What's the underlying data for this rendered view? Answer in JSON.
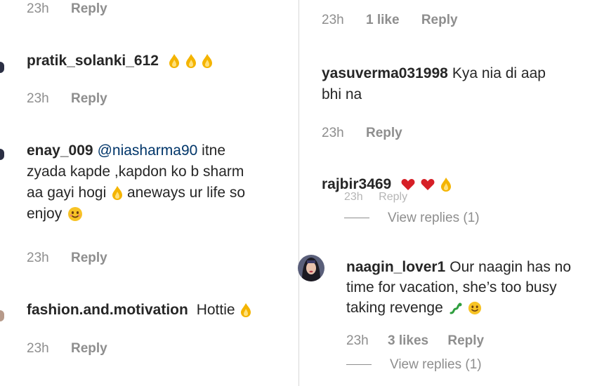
{
  "left": {
    "row0": {
      "time": "23h",
      "reply": "Reply"
    },
    "c1": {
      "user": "pratik_solanki_612",
      "text": "",
      "emoji": [
        "fire",
        "fire",
        "fire"
      ],
      "time": "23h",
      "reply": "Reply"
    },
    "c2": {
      "user": "enay_009",
      "mention": "@niasharma90",
      "line1": "itne",
      "line2": "zyada kapde ,kapdon ko b sharm",
      "line3a": "aa gayi hogi",
      "line3b": "aneways ur life so",
      "line4": "enjoy",
      "time": "23h",
      "reply": "Reply"
    },
    "c3": {
      "user": "fashion.and.motivation",
      "text": "Hottie",
      "time": "23h",
      "reply": "Reply"
    }
  },
  "right": {
    "row0": {
      "time": "23h",
      "likes": "1 like",
      "reply": "Reply"
    },
    "c1": {
      "user": "yasuverma031998",
      "text": "Kya nia di aap",
      "text2": "bhi na",
      "time": "23h",
      "reply": "Reply"
    },
    "c2": {
      "user": "rajbir3469",
      "ghost_time": "23h",
      "ghost_reply": "Reply",
      "view_replies": "View replies (1)"
    },
    "c3": {
      "user": "naagin_lover1",
      "text": "Our naagin has no",
      "text2": "time for vacation, she’s too busy",
      "text3": "taking revenge",
      "time": "23h",
      "likes": "3 likes",
      "reply": "Reply",
      "view_replies": "View replies (1)"
    }
  },
  "colors": {
    "text": "#262626",
    "meta": "#8e8e8e",
    "mention": "#003569",
    "heart": "#ed4956",
    "fire": "#f4b400"
  },
  "icons": [
    "fire-emoji",
    "heart-emoji",
    "smiling-face-emoji",
    "snake-emoji"
  ]
}
